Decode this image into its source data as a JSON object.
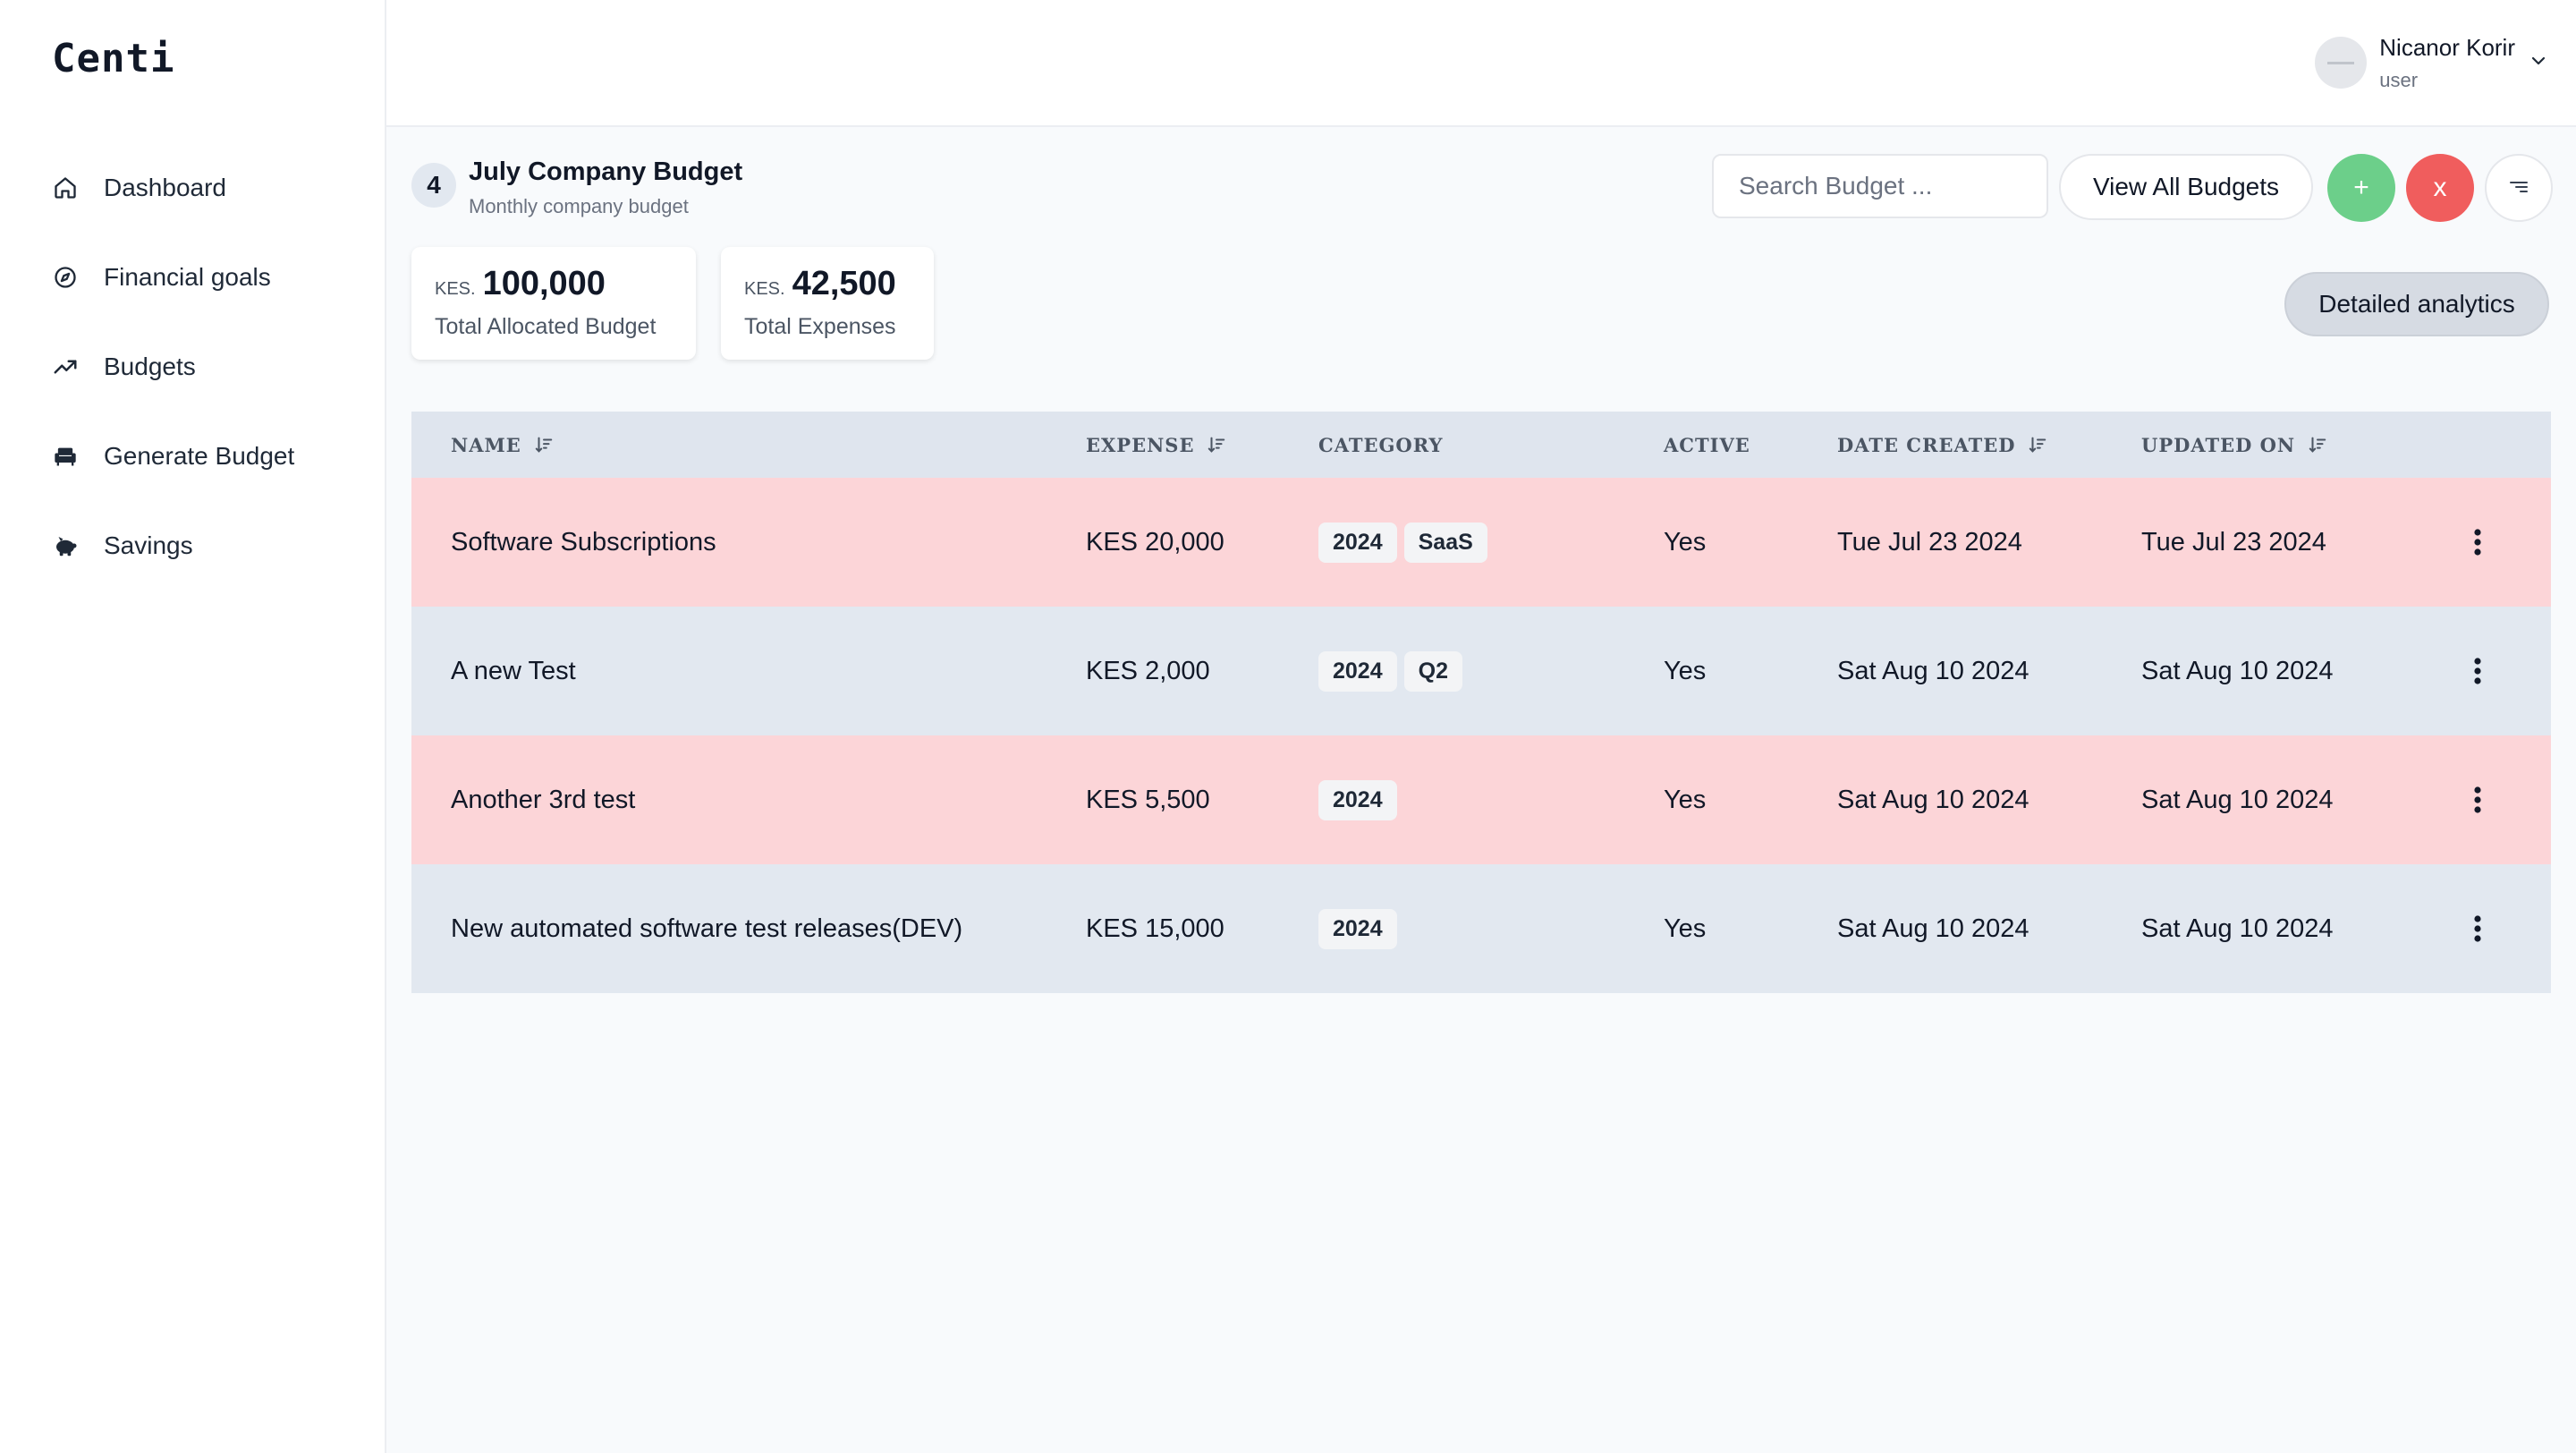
{
  "app": {
    "logo": "Centi"
  },
  "sidebar": {
    "items": [
      {
        "label": "Dashboard",
        "icon": "home-icon"
      },
      {
        "label": "Financial goals",
        "icon": "compass-icon"
      },
      {
        "label": "Budgets",
        "icon": "trending-up-icon"
      },
      {
        "label": "Generate Budget",
        "icon": "sofa-icon"
      },
      {
        "label": "Savings",
        "icon": "piggy-bank-icon"
      }
    ]
  },
  "header": {
    "user": {
      "name": "Nicanor Korir",
      "role": "user"
    }
  },
  "budget": {
    "count": "4",
    "title": "July Company Budget",
    "subtitle": "Monthly company budget"
  },
  "toolbar": {
    "search_placeholder": "Search Budget ...",
    "view_all_label": "View All Budgets",
    "add_label": "+",
    "close_label": "x"
  },
  "stats": {
    "allocated": {
      "currency": "KES.",
      "amount": "100,000",
      "caption": "Total Allocated Budget"
    },
    "expenses": {
      "currency": "KES.",
      "amount": "42,500",
      "caption": "Total Expenses"
    }
  },
  "analytics_label": "Detailed analytics",
  "table": {
    "columns": {
      "name": "NAME",
      "expense": "EXPENSE",
      "category": "CATEGORY",
      "active": "ACTIVE",
      "date_created": "DATE CREATED",
      "updated_on": "UPDATED ON"
    },
    "rows": [
      {
        "name": "Software Subscriptions",
        "expense": "KES 20,000",
        "tags": [
          "2024",
          "SaaS"
        ],
        "active": "Yes",
        "date_created": "Tue Jul 23 2024",
        "updated_on": "Tue Jul 23 2024",
        "highlight": "#fcd5d8"
      },
      {
        "name": "A new Test",
        "expense": "KES 2,000",
        "tags": [
          "2024",
          "Q2"
        ],
        "active": "Yes",
        "date_created": "Sat Aug 10 2024",
        "updated_on": "Sat Aug 10 2024",
        "highlight": "#e2e8f0"
      },
      {
        "name": "Another 3rd test",
        "expense": "KES 5,500",
        "tags": [
          "2024"
        ],
        "active": "Yes",
        "date_created": "Sat Aug 10 2024",
        "updated_on": "Sat Aug 10 2024",
        "highlight": "#fcd5d8"
      },
      {
        "name": "New automated software test releases(DEV)",
        "expense": "KES 15,000",
        "tags": [
          "2024"
        ],
        "active": "Yes",
        "date_created": "Sat Aug 10 2024",
        "updated_on": "Sat Aug 10 2024",
        "highlight": "#e2e8f0"
      }
    ]
  },
  "colors": {
    "add_button": "#6ccf8a",
    "close_button": "#f05d5d",
    "row_pink": "#fcd5d8",
    "row_gray": "#e2e8f0",
    "table_header": "#dfe5ee"
  }
}
